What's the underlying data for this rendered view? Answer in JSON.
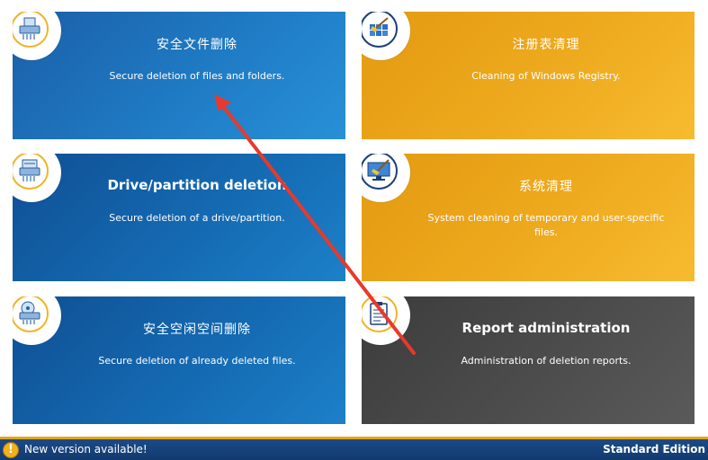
{
  "tiles": [
    {
      "title": "安全文件删除",
      "desc": "Secure deletion of files and folders.",
      "icon": "file-shredder-icon"
    },
    {
      "title": "注册表清理",
      "desc": "Cleaning of Windows Registry.",
      "icon": "registry-cleaner-icon"
    },
    {
      "title": "Drive/partition deletion",
      "desc": "Secure deletion of a drive/partition.",
      "icon": "drive-shredder-icon"
    },
    {
      "title": "系统清理",
      "desc": "System cleaning of temporary and user-specific files.",
      "icon": "system-cleaner-icon"
    },
    {
      "title": "安全空闲空间删除",
      "desc": "Secure deletion of already deleted files.",
      "icon": "free-space-shredder-icon"
    },
    {
      "title": "Report administration",
      "desc": "Administration of deletion reports.",
      "icon": "report-clipboard-icon"
    }
  ],
  "status_bar": {
    "update_icon": "warning-icon",
    "update_text": "New version available!",
    "edition": "Standard Edition"
  },
  "colors": {
    "blue_tile": "#1f7bc4",
    "orange_tile": "#eeaa1e",
    "gray_tile": "#4c4c4c",
    "status_bar": "#1b4a86",
    "accent": "#e8a317",
    "annotation_arrow": "#e8392b"
  }
}
